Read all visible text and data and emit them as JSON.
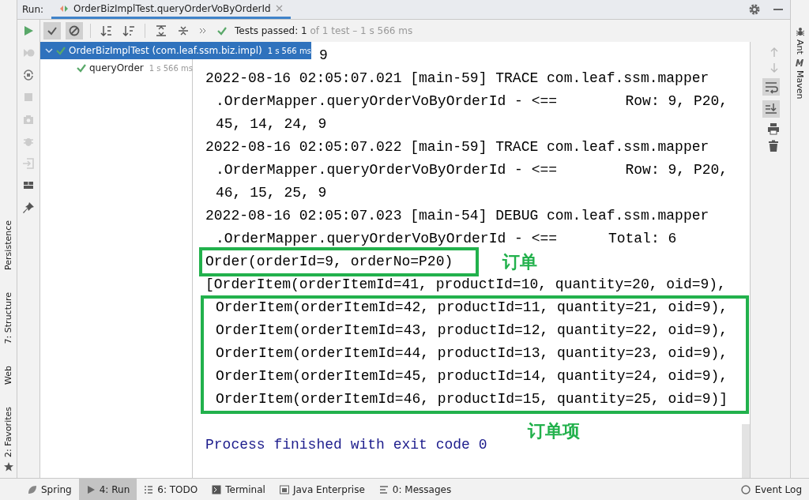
{
  "run_tab": {
    "label": "Run:",
    "title": "OrderBizImplTest.queryOrderVoByOrderId",
    "selected": true
  },
  "toolbar": {
    "status_label": "Tests passed:",
    "passed": "1",
    "summary": "of 1 test – 1 s 566 ms"
  },
  "test_tree": [
    {
      "name": "OrderBizImplTest (com.leaf.ssm.biz.impl)",
      "time": "1 s 566 ms",
      "passed": true,
      "selected": true,
      "expanded": true,
      "children": [
        {
          "name": "queryOrder",
          "time": "1 s 566 ms",
          "passed": true,
          "selected": false
        }
      ]
    }
  ],
  "console": {
    "lines": [
      {
        "text": "9",
        "kind": "clipped"
      },
      {
        "text": "2022-08-16 02:05:07.021 [main-59] TRACE com.leaf.ssm.mapper",
        "kind": "log"
      },
      {
        "text": ".OrderMapper.queryOrderVoByOrderId - <==        Row: 9, P20,",
        "kind": "cont"
      },
      {
        "text": "45, 14, 24, 9",
        "kind": "cont"
      },
      {
        "text": "2022-08-16 02:05:07.022 [main-59] TRACE com.leaf.ssm.mapper",
        "kind": "log"
      },
      {
        "text": ".OrderMapper.queryOrderVoByOrderId - <==        Row: 9, P20,",
        "kind": "cont"
      },
      {
        "text": "46, 15, 25, 9",
        "kind": "cont"
      },
      {
        "text": "2022-08-16 02:05:07.023 [main-54] DEBUG com.leaf.ssm.mapper",
        "kind": "log"
      },
      {
        "text": ".OrderMapper.queryOrderVoByOrderId - <==      Total: 6",
        "kind": "cont"
      },
      {
        "text": "Order(orderId=9, orderNo=P20)",
        "kind": "log"
      },
      {
        "text": "[OrderItem(orderItemId=41, productId=10, quantity=20, oid=9),",
        "kind": "log"
      },
      {
        "text": "OrderItem(orderItemId=42, productId=11, quantity=21, oid=9),",
        "kind": "cont"
      },
      {
        "text": "OrderItem(orderItemId=43, productId=12, quantity=22, oid=9),",
        "kind": "cont"
      },
      {
        "text": "OrderItem(orderItemId=44, productId=13, quantity=23, oid=9),",
        "kind": "cont"
      },
      {
        "text": "OrderItem(orderItemId=45, productId=14, quantity=24, oid=9),",
        "kind": "cont"
      },
      {
        "text": "OrderItem(orderItemId=46, productId=15, quantity=25, oid=9)]",
        "kind": "cont"
      },
      {
        "text": "Process finished with exit code 0",
        "kind": "exit"
      }
    ]
  },
  "annotations": [
    {
      "label": "订单"
    },
    {
      "label": "订单项"
    }
  ],
  "left_tool_windows": [
    "Persistence",
    "7: Structure",
    "Web",
    "2: Favorites"
  ],
  "right_tool_windows": [
    "Ant",
    "Maven"
  ],
  "bottom_tabs": [
    {
      "label": "Spring",
      "selected": false
    },
    {
      "label": "4: Run",
      "selected": true
    },
    {
      "label": "6: TODO",
      "selected": false
    },
    {
      "label": "Terminal",
      "selected": false
    },
    {
      "label": "Java Enterprise",
      "selected": false
    },
    {
      "label": "0: Messages",
      "selected": false
    }
  ],
  "event_log": "Event Log"
}
